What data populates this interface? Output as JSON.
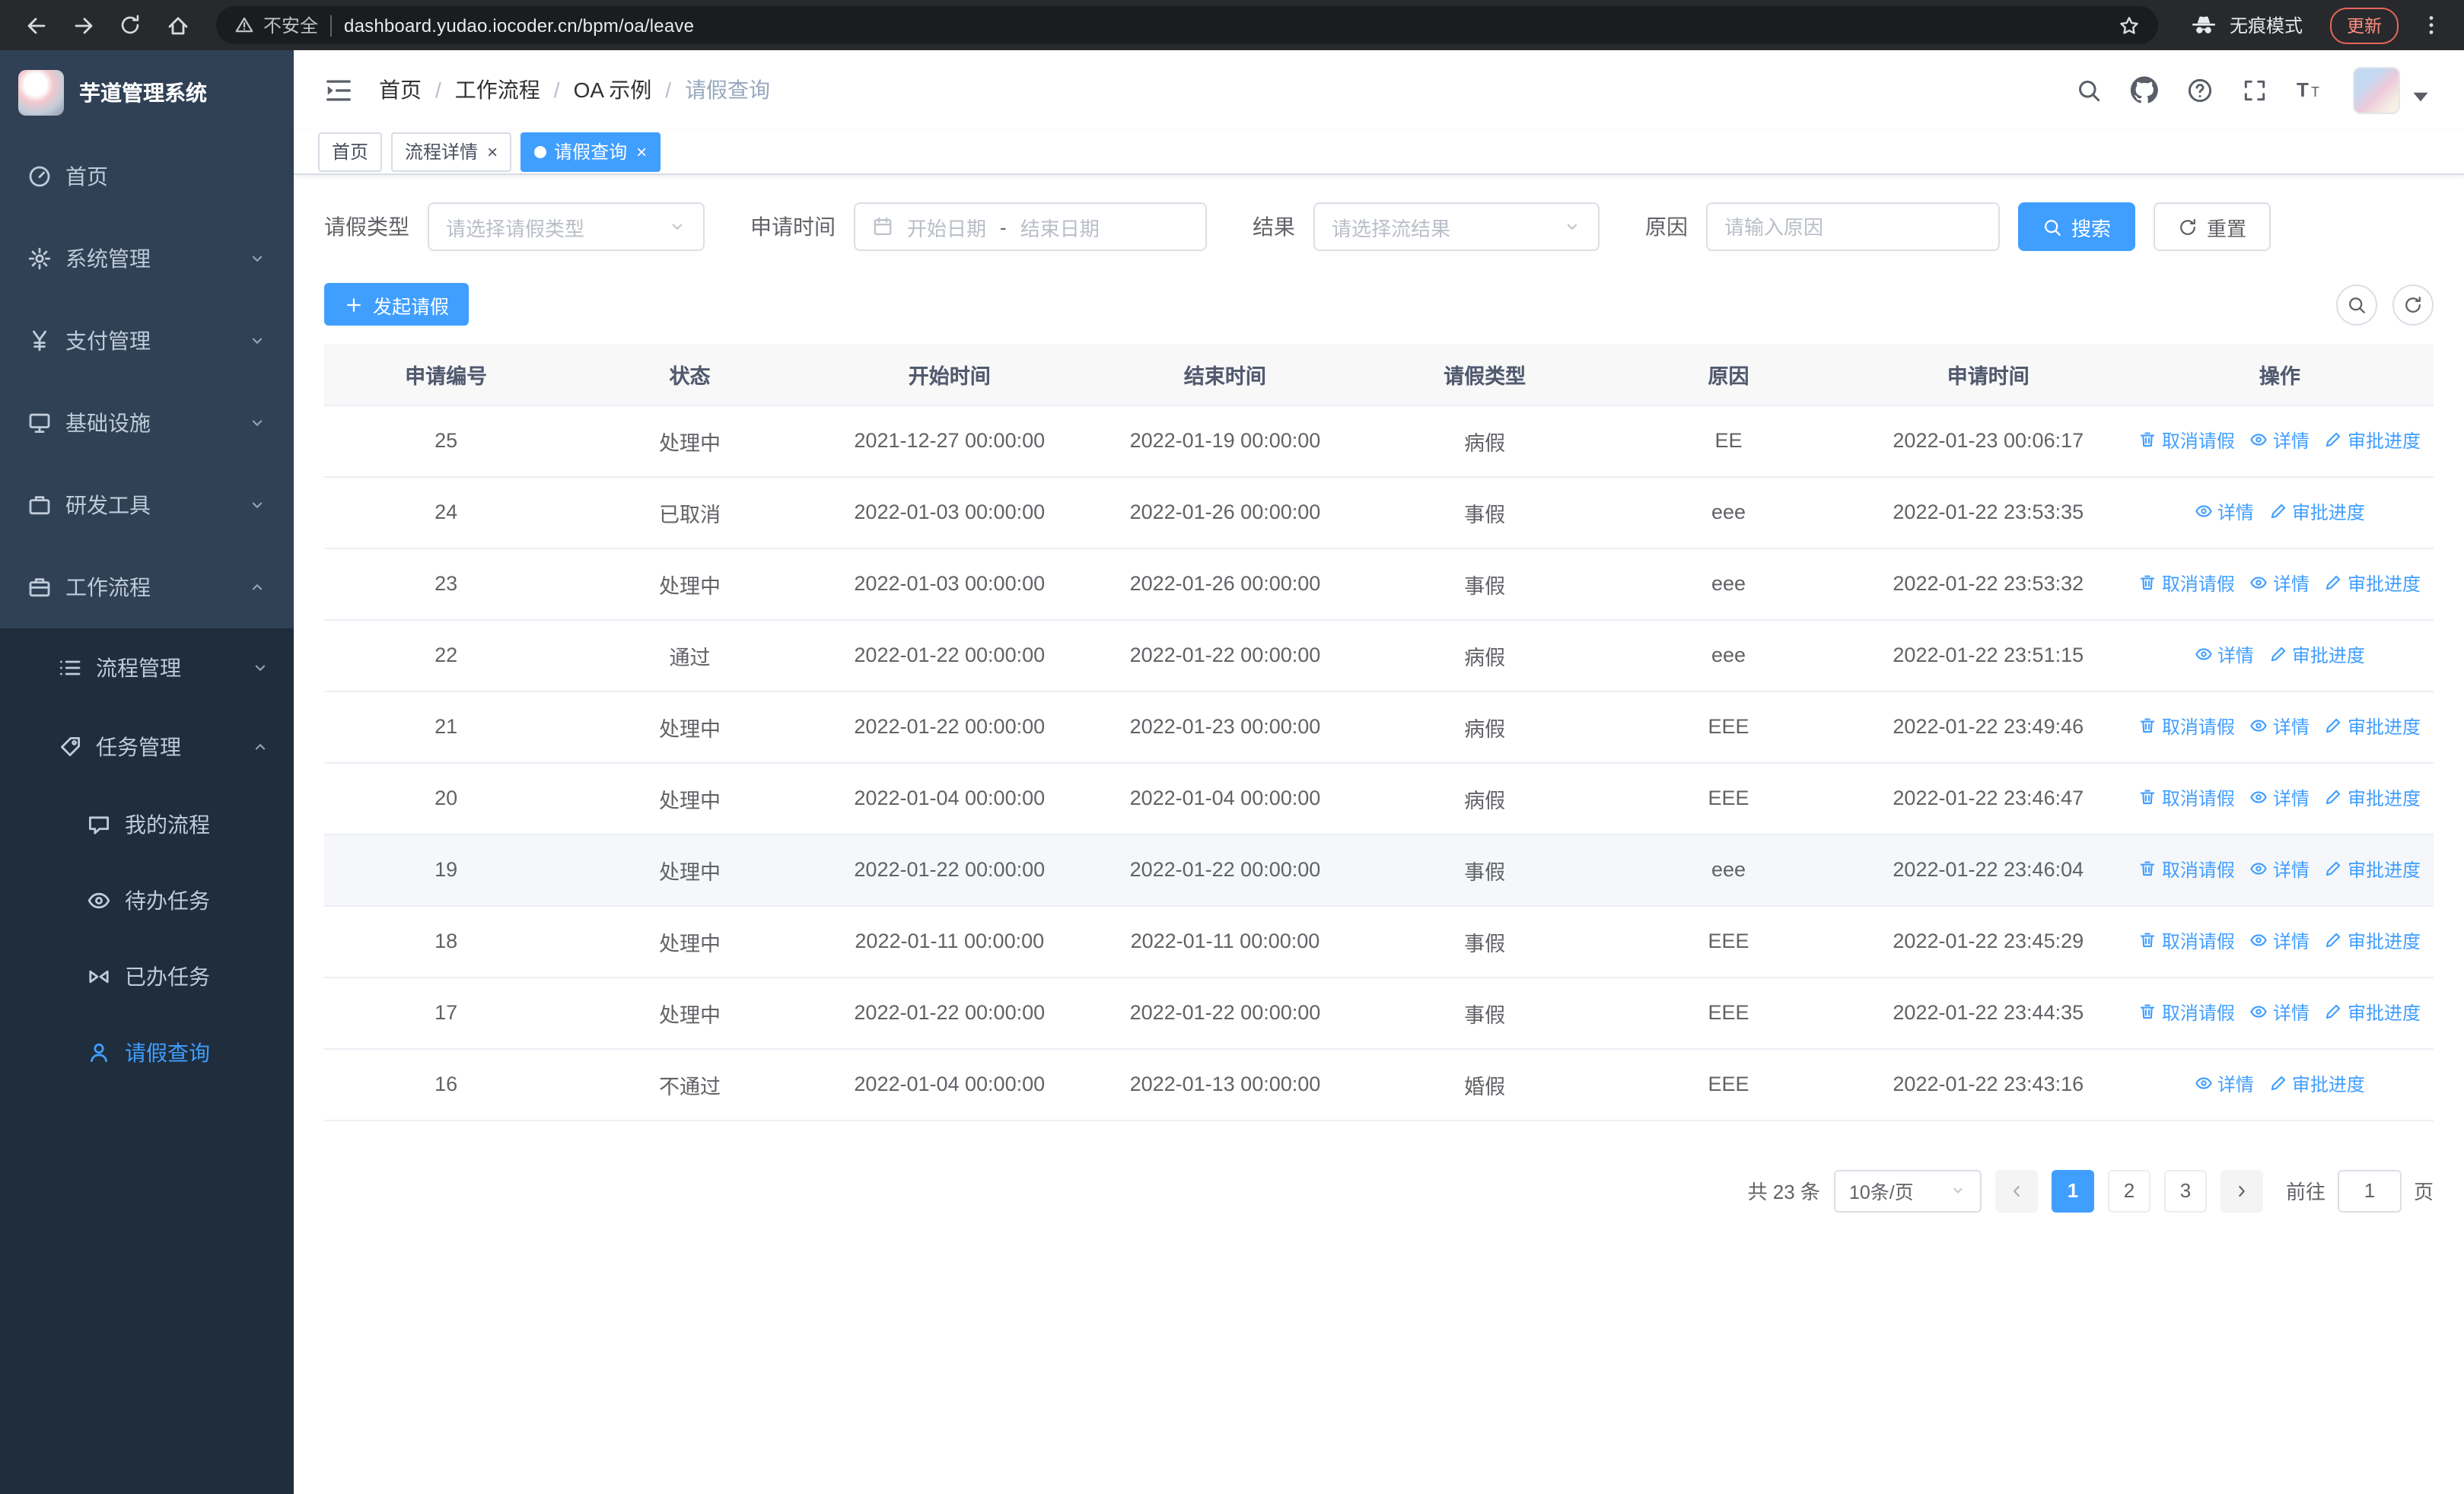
{
  "browser": {
    "security_label": "不安全",
    "url": "dashboard.yudao.iocoder.cn/bpm/oa/leave",
    "incognito_label": "无痕模式",
    "update_label": "更新"
  },
  "sidebar": {
    "logo_title": "芋道管理系统",
    "items": [
      {
        "key": "home",
        "label": "首页",
        "icon": "dashboard-icon",
        "expandable": false,
        "expanded": false
      },
      {
        "key": "system",
        "label": "系统管理",
        "icon": "gear-icon",
        "expandable": true,
        "expanded": false
      },
      {
        "key": "payment",
        "label": "支付管理",
        "icon": "yen-icon",
        "expandable": true,
        "expanded": false
      },
      {
        "key": "infrastructure",
        "label": "基础设施",
        "icon": "server-icon",
        "expandable": true,
        "expanded": false
      },
      {
        "key": "devtools",
        "label": "研发工具",
        "icon": "briefcase-icon",
        "expandable": true,
        "expanded": false
      },
      {
        "key": "workflow",
        "label": "工作流程",
        "icon": "workflow-icon",
        "expandable": true,
        "expanded": true
      }
    ],
    "submenu": [
      {
        "key": "process-mgmt",
        "label": "流程管理",
        "icon": "list-icon",
        "level": 2,
        "expandable": true,
        "expanded": false,
        "active": false
      },
      {
        "key": "task-mgmt",
        "label": "任务管理",
        "icon": "tag-icon",
        "level": 2,
        "expandable": true,
        "expanded": true,
        "active": false
      },
      {
        "key": "my-process",
        "label": "我的流程",
        "icon": "chat-icon",
        "level": 3,
        "expandable": false,
        "active": false
      },
      {
        "key": "todo-tasks",
        "label": "待办任务",
        "icon": "eye-icon",
        "level": 3,
        "expandable": false,
        "active": false
      },
      {
        "key": "done-tasks",
        "label": "已办任务",
        "icon": "bowtie-icon",
        "level": 3,
        "expandable": false,
        "active": false
      },
      {
        "key": "leave-query",
        "label": "请假查询",
        "icon": "user-icon",
        "level": 3,
        "expandable": false,
        "active": true
      }
    ]
  },
  "header": {
    "breadcrumb": [
      "首页",
      "工作流程",
      "OA 示例",
      "请假查询"
    ]
  },
  "tabs": [
    {
      "key": "home",
      "label": "首页",
      "closable": false,
      "active": false
    },
    {
      "key": "process-detail",
      "label": "流程详情",
      "closable": true,
      "active": false
    },
    {
      "key": "leave-query",
      "label": "请假查询",
      "closable": true,
      "active": true
    }
  ],
  "filters": {
    "leave_type_label": "请假类型",
    "leave_type_placeholder": "请选择请假类型",
    "apply_time_label": "申请时间",
    "start_date_placeholder": "开始日期",
    "date_separator": "-",
    "end_date_placeholder": "结束日期",
    "result_label": "结果",
    "result_placeholder": "请选择流结果",
    "reason_label": "原因",
    "reason_placeholder": "请输入原因",
    "search_label": "搜索",
    "reset_label": "重置"
  },
  "toolbar": {
    "create_label": "发起请假"
  },
  "table": {
    "headers": [
      "申请编号",
      "状态",
      "开始时间",
      "结束时间",
      "请假类型",
      "原因",
      "申请时间",
      "操作"
    ],
    "action_labels": {
      "cancel": "取消请假",
      "detail": "详情",
      "progress": "审批进度"
    },
    "rows": [
      {
        "id": "25",
        "status": "处理中",
        "start": "2021-12-27 00:00:00",
        "end": "2022-01-19 00:00:00",
        "type": "病假",
        "reason": "EE",
        "applied": "2022-01-23 00:06:17",
        "actions": [
          "cancel",
          "detail",
          "progress"
        ],
        "highlighted": false
      },
      {
        "id": "24",
        "status": "已取消",
        "start": "2022-01-03 00:00:00",
        "end": "2022-01-26 00:00:00",
        "type": "事假",
        "reason": "eee",
        "applied": "2022-01-22 23:53:35",
        "actions": [
          "detail",
          "progress"
        ],
        "highlighted": false
      },
      {
        "id": "23",
        "status": "处理中",
        "start": "2022-01-03 00:00:00",
        "end": "2022-01-26 00:00:00",
        "type": "事假",
        "reason": "eee",
        "applied": "2022-01-22 23:53:32",
        "actions": [
          "cancel",
          "detail",
          "progress"
        ],
        "highlighted": false
      },
      {
        "id": "22",
        "status": "通过",
        "start": "2022-01-22 00:00:00",
        "end": "2022-01-22 00:00:00",
        "type": "病假",
        "reason": "eee",
        "applied": "2022-01-22 23:51:15",
        "actions": [
          "detail",
          "progress"
        ],
        "highlighted": false
      },
      {
        "id": "21",
        "status": "处理中",
        "start": "2022-01-22 00:00:00",
        "end": "2022-01-23 00:00:00",
        "type": "病假",
        "reason": "EEE",
        "applied": "2022-01-22 23:49:46",
        "actions": [
          "cancel",
          "detail",
          "progress"
        ],
        "highlighted": false
      },
      {
        "id": "20",
        "status": "处理中",
        "start": "2022-01-04 00:00:00",
        "end": "2022-01-04 00:00:00",
        "type": "病假",
        "reason": "EEE",
        "applied": "2022-01-22 23:46:47",
        "actions": [
          "cancel",
          "detail",
          "progress"
        ],
        "highlighted": false
      },
      {
        "id": "19",
        "status": "处理中",
        "start": "2022-01-22 00:00:00",
        "end": "2022-01-22 00:00:00",
        "type": "事假",
        "reason": "eee",
        "applied": "2022-01-22 23:46:04",
        "actions": [
          "cancel",
          "detail",
          "progress"
        ],
        "highlighted": true
      },
      {
        "id": "18",
        "status": "处理中",
        "start": "2022-01-11 00:00:00",
        "end": "2022-01-11 00:00:00",
        "type": "事假",
        "reason": "EEE",
        "applied": "2022-01-22 23:45:29",
        "actions": [
          "cancel",
          "detail",
          "progress"
        ],
        "highlighted": false
      },
      {
        "id": "17",
        "status": "处理中",
        "start": "2022-01-22 00:00:00",
        "end": "2022-01-22 00:00:00",
        "type": "事假",
        "reason": "EEE",
        "applied": "2022-01-22 23:44:35",
        "actions": [
          "cancel",
          "detail",
          "progress"
        ],
        "highlighted": false
      },
      {
        "id": "16",
        "status": "不通过",
        "start": "2022-01-04 00:00:00",
        "end": "2022-01-13 00:00:00",
        "type": "婚假",
        "reason": "EEE",
        "applied": "2022-01-22 23:43:16",
        "actions": [
          "detail",
          "progress"
        ],
        "highlighted": false
      }
    ]
  },
  "pagination": {
    "total_label": "共 23 条",
    "page_size_label": "10条/页",
    "pages": [
      "1",
      "2",
      "3"
    ],
    "active_page": "1",
    "goto_label": "前往",
    "goto_value": "1",
    "page_unit_label": "页"
  },
  "colors": {
    "primary": "#409eff",
    "sidebar_bg": "#304156",
    "submenu_bg": "#1f2d3d",
    "table_header_bg": "#f8f8f9",
    "update_badge": "#e5675a"
  }
}
